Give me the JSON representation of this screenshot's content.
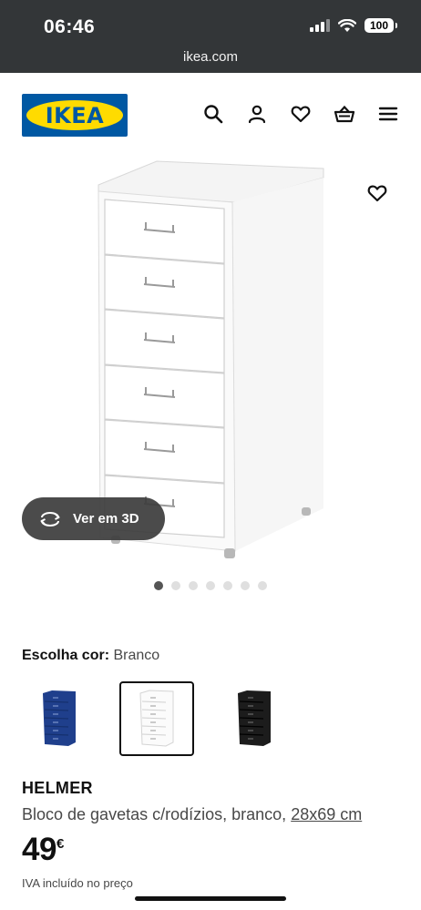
{
  "status_bar": {
    "time": "06:46",
    "battery": "100",
    "url": "ikea.com"
  },
  "header": {
    "logo_text": "IKEA",
    "icons": [
      "search-icon",
      "account-icon",
      "heart-icon",
      "basket-icon",
      "menu-icon"
    ]
  },
  "gallery": {
    "view3d_label": "Ver em 3D",
    "image_count": 7,
    "active_index": 0
  },
  "product": {
    "color_label": "Escolha cor:",
    "color_value": "Branco",
    "swatches": [
      {
        "color": "#1f3f8c",
        "selected": false
      },
      {
        "color": "#ffffff",
        "selected": true
      },
      {
        "color": "#1c1c1c",
        "selected": false
      }
    ],
    "name": "HELMER",
    "description": "Bloco de gavetas c/rodízios, branco,",
    "size": "28x69 cm",
    "price": "49",
    "currency": "€",
    "vat_note": "IVA incluído no preço"
  },
  "colors": {
    "ikea_blue": "#0058a3",
    "ikea_yellow": "#ffdb00",
    "status_bg": "#333638"
  }
}
